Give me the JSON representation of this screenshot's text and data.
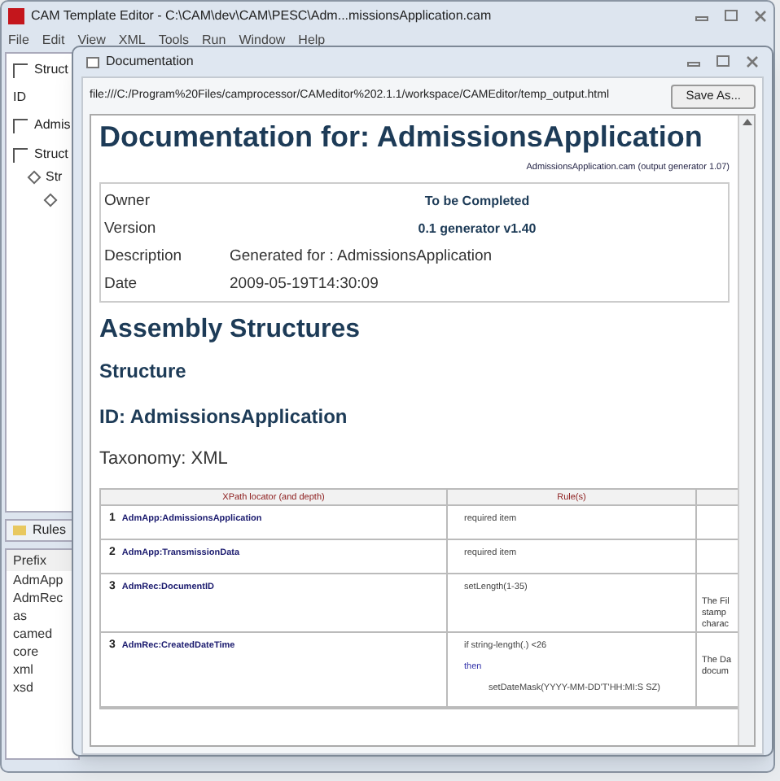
{
  "main_window": {
    "title": "CAM Template Editor - C:\\CAM\\dev\\CAM\\PESC\\Adm...missionsApplication.cam",
    "menu": [
      "File",
      "Edit",
      "View",
      "XML",
      "Tools",
      "Run",
      "Window",
      "Help"
    ]
  },
  "left_panel": {
    "items": [
      {
        "kind": "check",
        "label": "Struct",
        "checked": false
      },
      {
        "kind": "text",
        "label": "ID"
      },
      {
        "kind": "check",
        "label": "Admis",
        "checked": false
      }
    ],
    "tree": {
      "label": "Struct",
      "checked": false,
      "children": [
        {
          "kind": "node",
          "label": "Str",
          "children": [
            {
              "kind": "node"
            }
          ]
        }
      ]
    },
    "rules_tab": "Rules",
    "prefix_header": "Prefix",
    "prefixes": [
      "AdmApp",
      "AdmRec",
      "as",
      "camed",
      "core",
      "xml",
      "xsd"
    ]
  },
  "dialog": {
    "title": "Documentation",
    "url": "file:///C:/Program%20Files/camprocessor/CAMeditor%202.1.1/workspace/CAMEditor/temp_output.html",
    "save_button": "Save As...",
    "doc": {
      "heading": "Documentation for: AdmissionsApplication",
      "generator": "AdmissionsApplication.cam (output generator 1.07)",
      "info": [
        {
          "label": "Owner",
          "value": "To be Completed",
          "bold": true
        },
        {
          "label": "Version",
          "value": "0.1 generator v1.40",
          "bold": true
        },
        {
          "label": "Description",
          "value": "Generated for : AdmissionsApplication",
          "bold": false
        },
        {
          "label": "Date",
          "value": "2009-05-19T14:30:09",
          "bold": false
        }
      ],
      "section": "Assembly Structures",
      "subsection": "Structure",
      "id_heading": "ID: AdmissionsApplication",
      "taxonomy": "Taxonomy: XML",
      "table": {
        "columns": [
          "XPath locator (and depth)",
          "Rule(s)"
        ],
        "rows": [
          {
            "depth": "1",
            "xpath": "AdmApp:AdmissionsApplication",
            "rules": [
              {
                "kind": "text",
                "text": "required item"
              }
            ],
            "column_3": []
          },
          {
            "depth": "2",
            "xpath": "AdmApp:TransmissionData",
            "rules": [
              {
                "kind": "text",
                "text": "required item"
              }
            ],
            "column_3": []
          },
          {
            "depth": "3",
            "xpath": "AdmRec:DocumentID",
            "rules": [
              {
                "kind": "text",
                "text": "setLength(1-35)"
              }
            ],
            "column_3": [
              "The Fil",
              "stamp",
              "charac"
            ]
          },
          {
            "depth": "3",
            "xpath": "AdmRec:CreatedDateTime",
            "rules": [
              {
                "kind": "text",
                "text": "if string-length(.) <26"
              },
              {
                "kind": "keyword",
                "text": "then"
              },
              {
                "kind": "indent",
                "text": "setDateMask(YYYY-MM-DD'T'HH:MI:S SZ)"
              }
            ],
            "column_3": [
              "The Da",
              "docum"
            ]
          }
        ]
      }
    }
  }
}
